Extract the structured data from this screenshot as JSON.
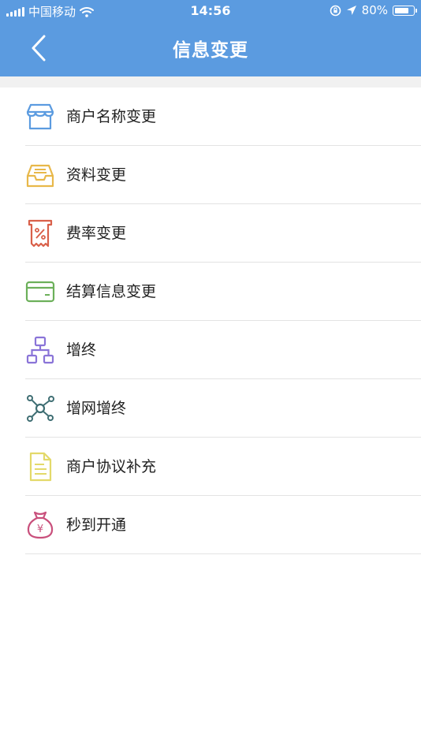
{
  "status_bar": {
    "carrier": "中国移动",
    "time": "14:56",
    "battery": "80%",
    "battery_level": 0.8
  },
  "header": {
    "title": "信息变更",
    "back_icon": "chevron-left-icon"
  },
  "menu": [
    {
      "label": "商户名称变更",
      "icon": "storefront-icon",
      "color": "#5b9be0"
    },
    {
      "label": "资料变更",
      "icon": "inbox-tray-icon",
      "color": "#e8b84a"
    },
    {
      "label": "费率变更",
      "icon": "percent-receipt-icon",
      "color": "#d9604a"
    },
    {
      "label": "结算信息变更",
      "icon": "bank-card-icon",
      "color": "#6cb05a"
    },
    {
      "label": "增终",
      "icon": "org-chart-icon",
      "color": "#8a74d8"
    },
    {
      "label": "增网增终",
      "icon": "network-nodes-icon",
      "color": "#3f6e73"
    },
    {
      "label": "商户协议补充",
      "icon": "document-icon",
      "color": "#e3d96a"
    },
    {
      "label": "秒到开通",
      "icon": "money-bag-icon",
      "color": "#c9507c"
    }
  ]
}
